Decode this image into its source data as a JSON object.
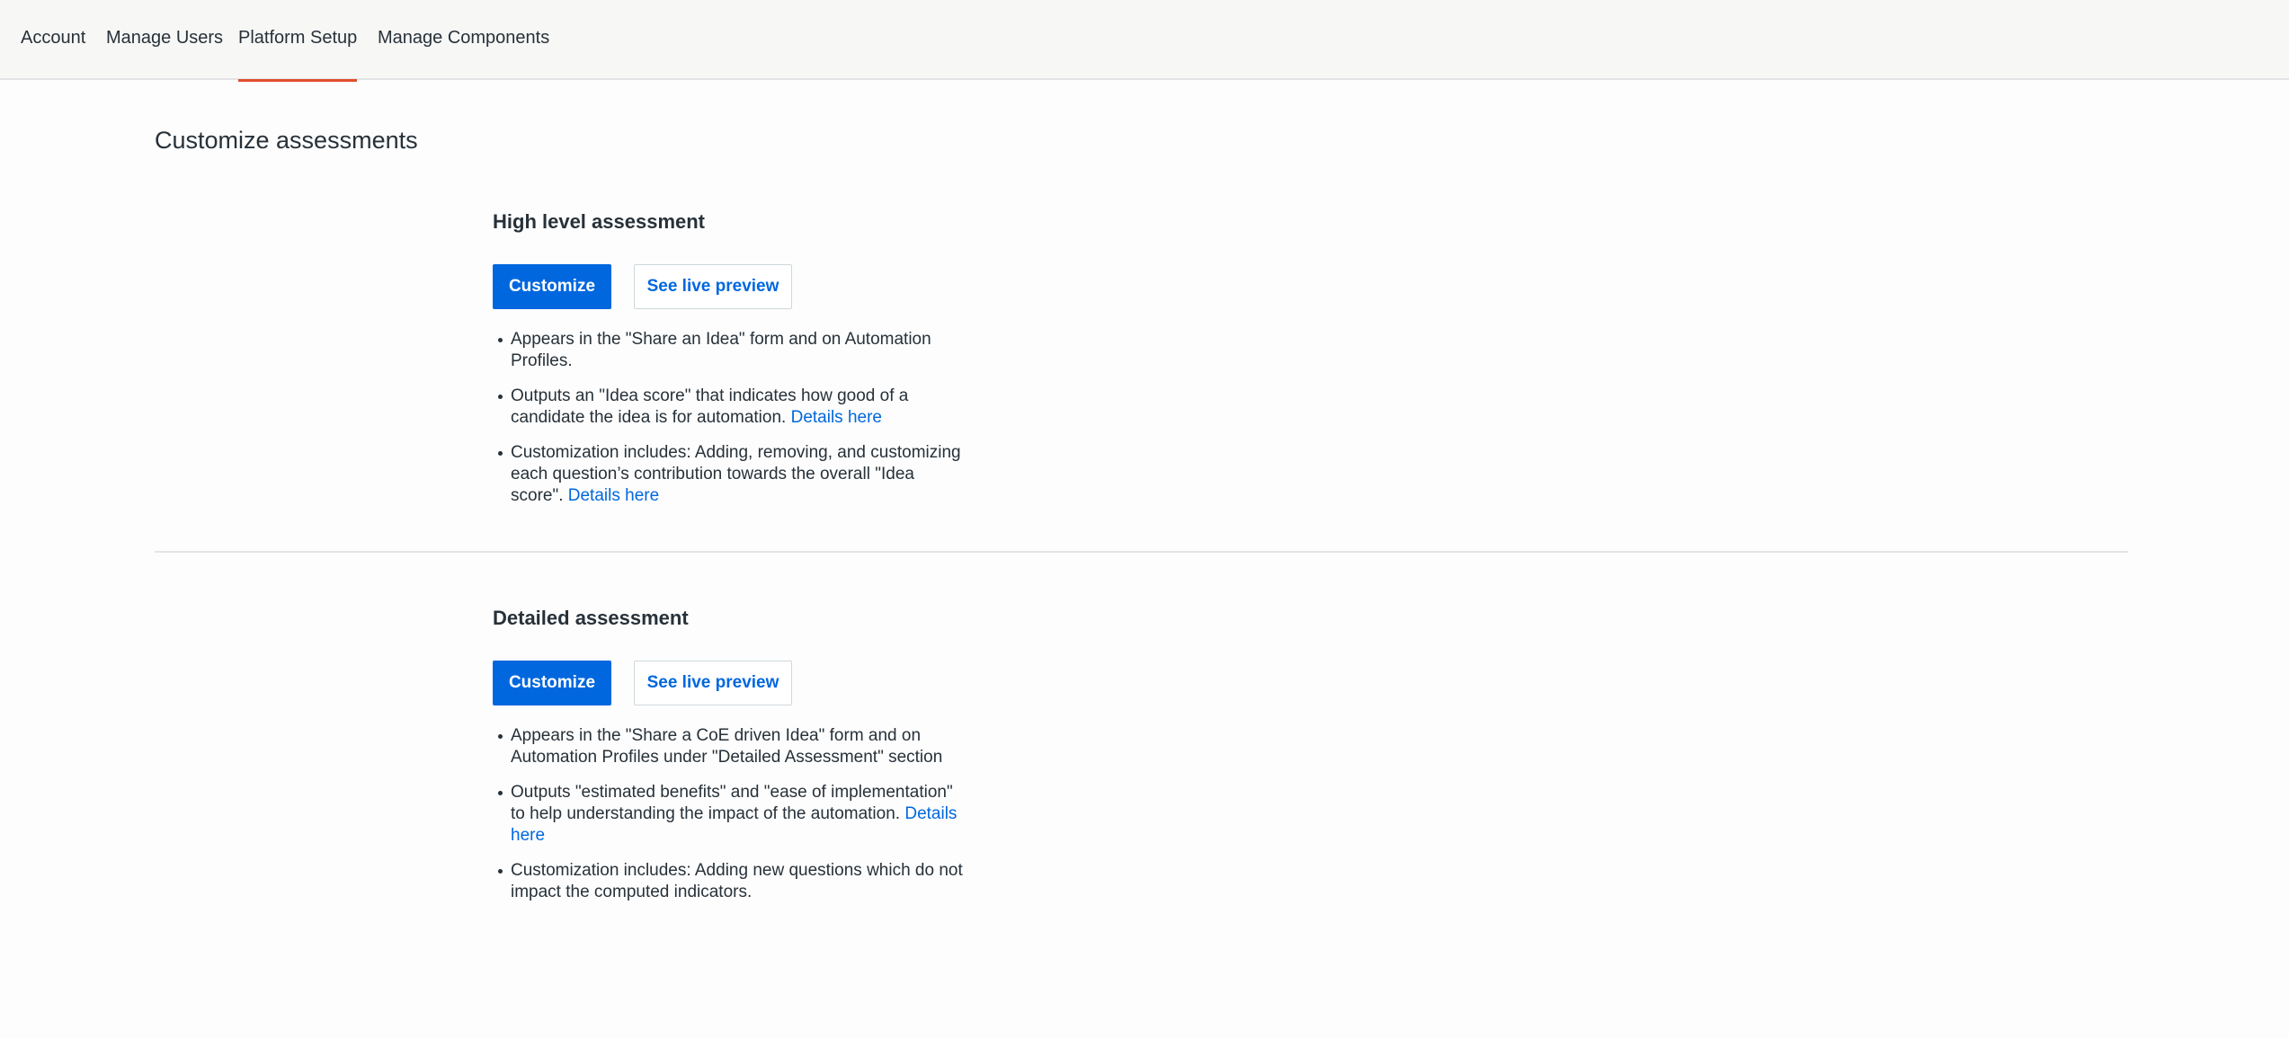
{
  "nav": {
    "tabs": [
      {
        "label": "Account"
      },
      {
        "label": "Manage Users"
      },
      {
        "label": "Platform Setup",
        "active": true
      },
      {
        "label": "Manage Components"
      }
    ],
    "active_color": "#e04e2c"
  },
  "page": {
    "title": "Customize assessments"
  },
  "high_level": {
    "title": "High level assessment",
    "customize_label": "Customize",
    "preview_label": "See live preview",
    "bullets": [
      {
        "text": "Appears in the \"Share an Idea\" form and on Automation Profiles."
      },
      {
        "text": "Outputs an \"Idea score\" that indicates how good of a candidate the idea is for automation. ",
        "link": "Details here"
      },
      {
        "text": "Customization includes: Adding, removing, and customizing each question’s contribution towards the overall \"Idea score\". ",
        "link": "Details here"
      }
    ]
  },
  "detailed": {
    "title": "Detailed assessment",
    "customize_label": "Customize",
    "preview_label": "See live preview",
    "bullets": [
      {
        "text": "Appears in the \"Share a CoE driven Idea\" form and on Automation Profiles under \"Detailed Assessment\" section"
      },
      {
        "text": "Outputs \"estimated benefits\" and \"ease of implementation\" to help understanding the impact of the automation. ",
        "link": "Details here"
      },
      {
        "text": "Customization includes: Adding new questions which do not impact the computed indicators."
      }
    ]
  },
  "colors": {
    "primary": "#0067df",
    "text": "#273139",
    "accent": "#e04e2c"
  }
}
